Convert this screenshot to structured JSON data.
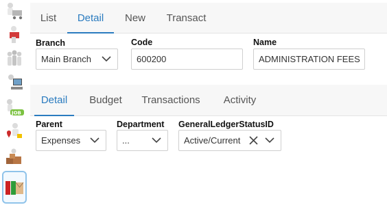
{
  "rail": {
    "items": [
      {
        "name": "cart-icon"
      },
      {
        "name": "delivery-person-icon"
      },
      {
        "name": "people-group-icon"
      },
      {
        "name": "computer-user-icon"
      },
      {
        "name": "job-icon"
      },
      {
        "name": "first-aid-person-icon"
      },
      {
        "name": "boxes-icon"
      },
      {
        "name": "ledger-books-icon"
      }
    ]
  },
  "top_tabs": [
    {
      "label": "List"
    },
    {
      "label": "Detail"
    },
    {
      "label": "New"
    },
    {
      "label": "Transact"
    }
  ],
  "top_active_tab": "Detail",
  "form": {
    "branch": {
      "label": "Branch",
      "value": "Main Branch"
    },
    "code": {
      "label": "Code",
      "value": "600200"
    },
    "name": {
      "label": "Name",
      "value": "ADMINISTRATION FEES"
    }
  },
  "sub_tabs": [
    {
      "label": "Detail"
    },
    {
      "label": "Budget"
    },
    {
      "label": "Transactions"
    },
    {
      "label": "Activity"
    }
  ],
  "sub_active_tab": "Detail",
  "detail": {
    "parent": {
      "label": "Parent",
      "value": "Expenses"
    },
    "department": {
      "label": "Department",
      "value": "..."
    },
    "status": {
      "label": "GeneralLedgerStatusID",
      "value": "Active/Current"
    }
  },
  "colors": {
    "accent": "#2a7bbf",
    "tab_bar": "#f7f7f7"
  }
}
